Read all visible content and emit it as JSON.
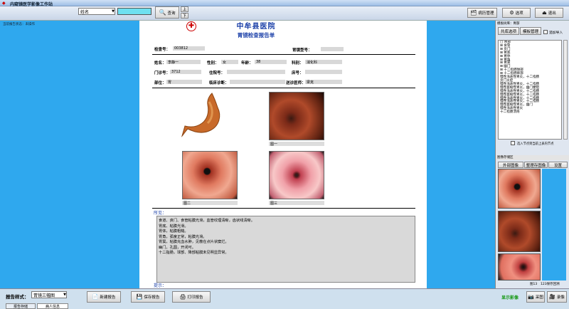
{
  "app": {
    "title": "内窥镜医学影像工作站"
  },
  "search": {
    "field_value": "姓名",
    "query_label": "查询",
    "up_label": "上",
    "down_label": "下"
  },
  "toolbar": {
    "case_mgmt": "病历管理",
    "options": "选项",
    "exit": "退出"
  },
  "left": {
    "status": "当前报告状态：未操作"
  },
  "report": {
    "hospital": "中牟县医院",
    "title": "胃镜检查报告单",
    "exam_no_label": "检查号：",
    "exam_no": "003812",
    "model_label": "胃镜型号：",
    "name_label": "姓名：",
    "name": "李静一",
    "sex_label": "性别：",
    "sex": "女",
    "age_label": "年龄：",
    "age": "38",
    "dept_label": "科别：",
    "dept": "消化科",
    "clinic_label": "门诊号：",
    "clinic": "3712",
    "inpatient_label": "住院号：",
    "bed_label": "床号：",
    "site_label": "部位：",
    "site": "胃",
    "diag_label": "临床诊断：",
    "doctor_label": "送诊医师：",
    "doctor": "梁克",
    "images": [
      "图一",
      "图二",
      "图三"
    ],
    "findings_label": "所见：",
    "findings": [
      "食道、贲门、食管粘膜光滑，血管纹理清晰，齿状线清晰。",
      "胃底、粘膜光滑。",
      "胃体，粘膜粗糙。",
      "胃角，弧度正常，粘膜光滑。",
      "胃窦，粘膜充血水肿，见散在点片状糜烂。",
      "幽门，孔圆，开闭可。",
      "十二指肠，球部、降部粘膜未见明显异常。"
    ],
    "hint_label": "提示："
  },
  "right": {
    "head": "模板树库：胃部",
    "tab_standard": "共库选项",
    "tab_template": "模板管理",
    "add_checkbox": "追加导入",
    "tree": [
      "□ 胃部",
      "  ⊞ 食管",
      "  ⊞ 贲门",
      "  ⊞ 胃底",
      "  ⊞ 胃体",
      "  ⊞ 胃角",
      "  ⊞ 胃窦",
      "  ⊞ 幽门",
      "  ⊞ 十二指肠球部",
      "  ⊞ 十二指肠降部",
      "    慢性浅表性胃炎，十二指肠",
      "    贲门炎症",
      "    慢性浅表性胃炎，十二指肠",
      "    慢性萎缩性胃炎，幽门梗阻",
      "    慢性浅表性胃炎，十二指肠",
      "    慢性萎缩性胃炎，十二指肠",
      "    慢性浅表性胃炎，十二指肠",
      "    慢性浅表性胃炎，十二指肠",
      "    慢性萎缩性胃炎，幽门",
      "    慢性浅表性胃炎",
      "    十二指肠溃疡"
    ],
    "choose_node": "选入节点到当前上表内节点",
    "gallery_head": "图像存储区",
    "ext_image": "外部图像",
    "sort_image": "整理存图像",
    "settings": "设置",
    "count": "图13",
    "save_label": "123保存回溯"
  },
  "bottom": {
    "style_label": "报告样式：",
    "style_value": "胃镜三幅图",
    "new_report": "新建报告",
    "save_report": "保存报告",
    "print_report": "打印报告",
    "tab_report": "报告存储",
    "tab_patient": "病人信息",
    "show_image": "显示影像",
    "capture": "采图",
    "record": "录像"
  },
  "colors": {
    "accent": "#2fa8ee",
    "title_blue": "#1a3fa8"
  }
}
